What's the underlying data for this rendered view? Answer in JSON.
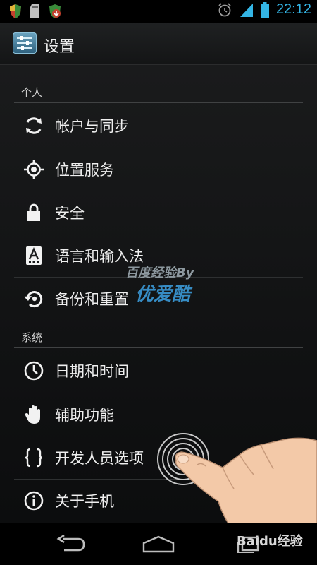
{
  "status_bar": {
    "time": "22:12",
    "left_icons": [
      "shield-icon",
      "sd-card-icon",
      "download-shield-icon"
    ],
    "right_icons": [
      "alarm-icon",
      "signal-icon",
      "battery-icon"
    ]
  },
  "action_bar": {
    "title": "设置",
    "icon": "settings-app-icon"
  },
  "sections": [
    {
      "title": "个人",
      "items": [
        {
          "label": "帐户与同步",
          "icon": "sync-icon"
        },
        {
          "label": "位置服务",
          "icon": "location-icon"
        },
        {
          "label": "安全",
          "icon": "lock-icon"
        },
        {
          "label": "语言和输入法",
          "icon": "keyboard-language-icon"
        },
        {
          "label": "备份和重置",
          "icon": "backup-reset-icon"
        }
      ]
    },
    {
      "title": "系统",
      "items": [
        {
          "label": "日期和时间",
          "icon": "clock-icon"
        },
        {
          "label": "辅助功能",
          "icon": "hand-icon"
        },
        {
          "label": "开发人员选项",
          "icon": "braces-icon"
        },
        {
          "label": "关于手机",
          "icon": "info-icon"
        }
      ]
    }
  ],
  "nav_bar": {
    "buttons": [
      "back-icon",
      "home-icon",
      "recents-icon"
    ]
  },
  "overlay": {
    "watermark_top": "百度经验By",
    "watermark_bottom": "优爱酷",
    "baidu_logo": "Baidu经验"
  },
  "colors": {
    "accent": "#34b5e5",
    "background": "#111213"
  }
}
